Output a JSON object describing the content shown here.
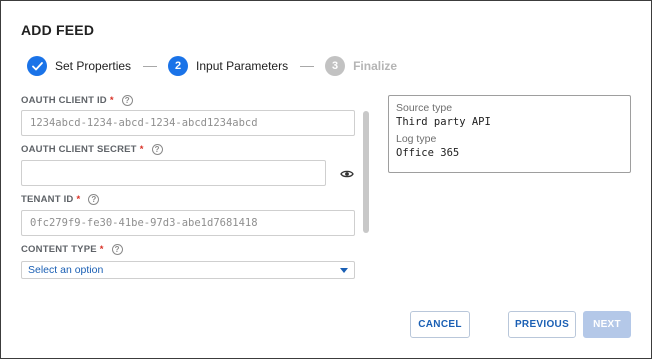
{
  "dialog": {
    "title": "ADD FEED"
  },
  "stepper": {
    "steps": [
      {
        "number": "",
        "label": "Set Properties",
        "state": "done"
      },
      {
        "number": "2",
        "label": "Input Parameters",
        "state": "active"
      },
      {
        "number": "3",
        "label": "Finalize",
        "state": "pending"
      }
    ]
  },
  "form": {
    "client_id": {
      "label": "OAUTH CLIENT ID",
      "required": "*",
      "value": "1234abcd-1234-abcd-1234-abcd1234abcd"
    },
    "client_secret": {
      "label": "OAUTH CLIENT SECRET",
      "required": "*",
      "value": ""
    },
    "tenant_id": {
      "label": "TENANT ID",
      "required": "*",
      "value": "0fc279f9-fe30-41be-97d3-abe1d7681418"
    },
    "content_type": {
      "label": "CONTENT TYPE",
      "required": "*",
      "placeholder": "Select an option"
    },
    "help_glyph": "?"
  },
  "info": {
    "source_type_label": "Source type",
    "source_type_value": "Third party API",
    "log_type_label": "Log type",
    "log_type_value": "Office 365"
  },
  "buttons": {
    "cancel": "CANCEL",
    "previous": "PREVIOUS",
    "next": "NEXT"
  },
  "colors": {
    "accent": "#1a73e8",
    "link": "#1a5fb4",
    "required": "#d93025",
    "disabled": "#b4c8e8"
  },
  "icons": {
    "step_done": "check-icon",
    "help": "help-circle-icon",
    "reveal": "eye-icon",
    "dropdown": "caret-down-icon"
  }
}
